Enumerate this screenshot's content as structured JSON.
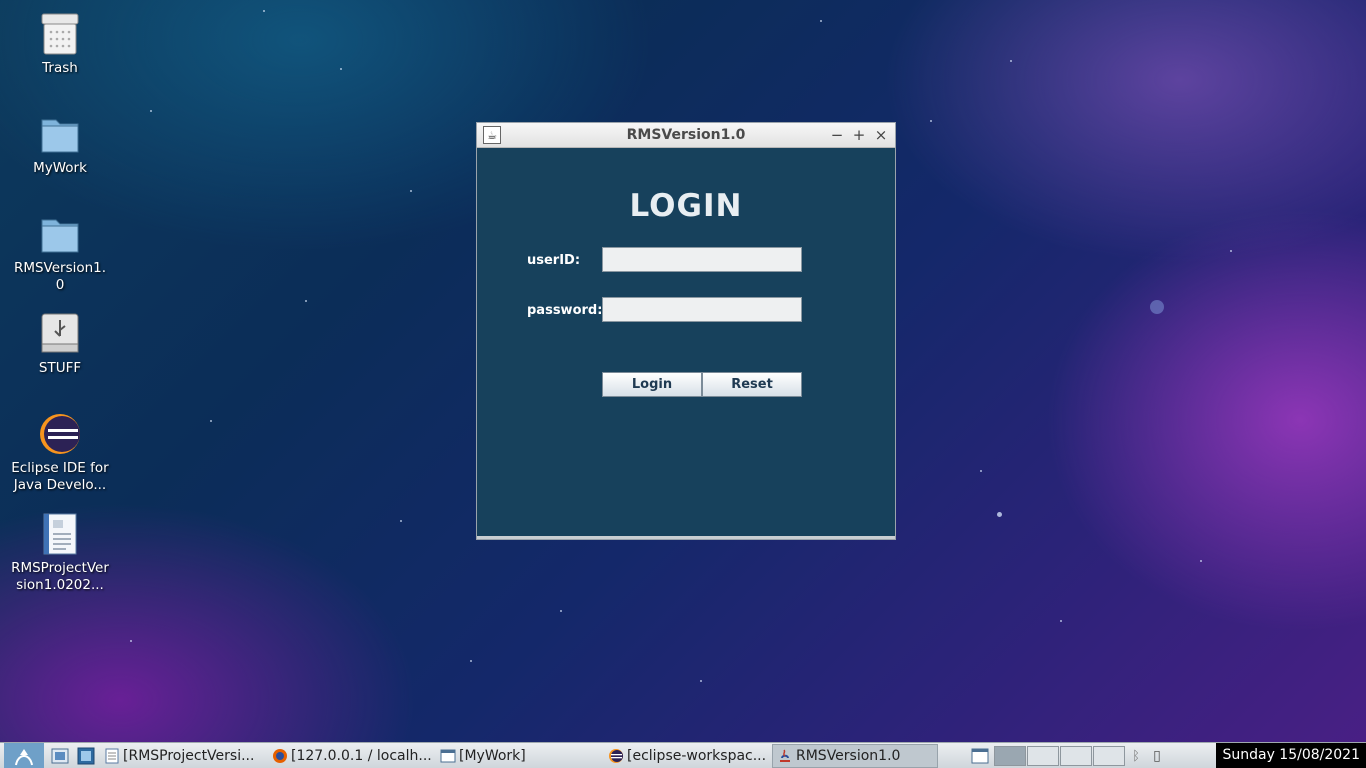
{
  "desktop": {
    "icons": [
      {
        "label": "Trash",
        "icon": "trash-icon"
      },
      {
        "label": "MyWork",
        "icon": "folder-icon"
      },
      {
        "label": "RMSVersion1.0",
        "icon": "folder-icon"
      },
      {
        "label": "STUFF",
        "icon": "usb-drive-icon"
      },
      {
        "label": "Eclipse IDE for Java Develo...",
        "icon": "eclipse-icon"
      },
      {
        "label": "RMSProjectVersion1.0202...",
        "icon": "document-icon"
      }
    ]
  },
  "window": {
    "title": "RMSVersion1.0",
    "controls": {
      "minimize": "−",
      "maximize": "+",
      "close": "×"
    },
    "heading": "LOGIN",
    "userid_label": "userID:",
    "userid_value": "",
    "password_label": "password:",
    "password_value": "",
    "login_button": "Login",
    "reset_button": "Reset"
  },
  "taskbar": {
    "tasks": [
      {
        "label": "[RMSProjectVersi...",
        "icon": "document-icon"
      },
      {
        "label": "[127.0.0.1 / localh...",
        "icon": "firefox-icon"
      },
      {
        "label": "[MyWork]",
        "icon": "window-icon"
      },
      {
        "label": "[eclipse-workspac...",
        "icon": "eclipse-icon"
      },
      {
        "label": "RMSVersion1.0",
        "icon": "java-icon",
        "active": true
      }
    ],
    "clock": "Sunday 15/08/2021"
  },
  "colors": {
    "window_bg": "#17415c",
    "heading": "#e8eef2",
    "taskbar": "#dfe4e8"
  }
}
